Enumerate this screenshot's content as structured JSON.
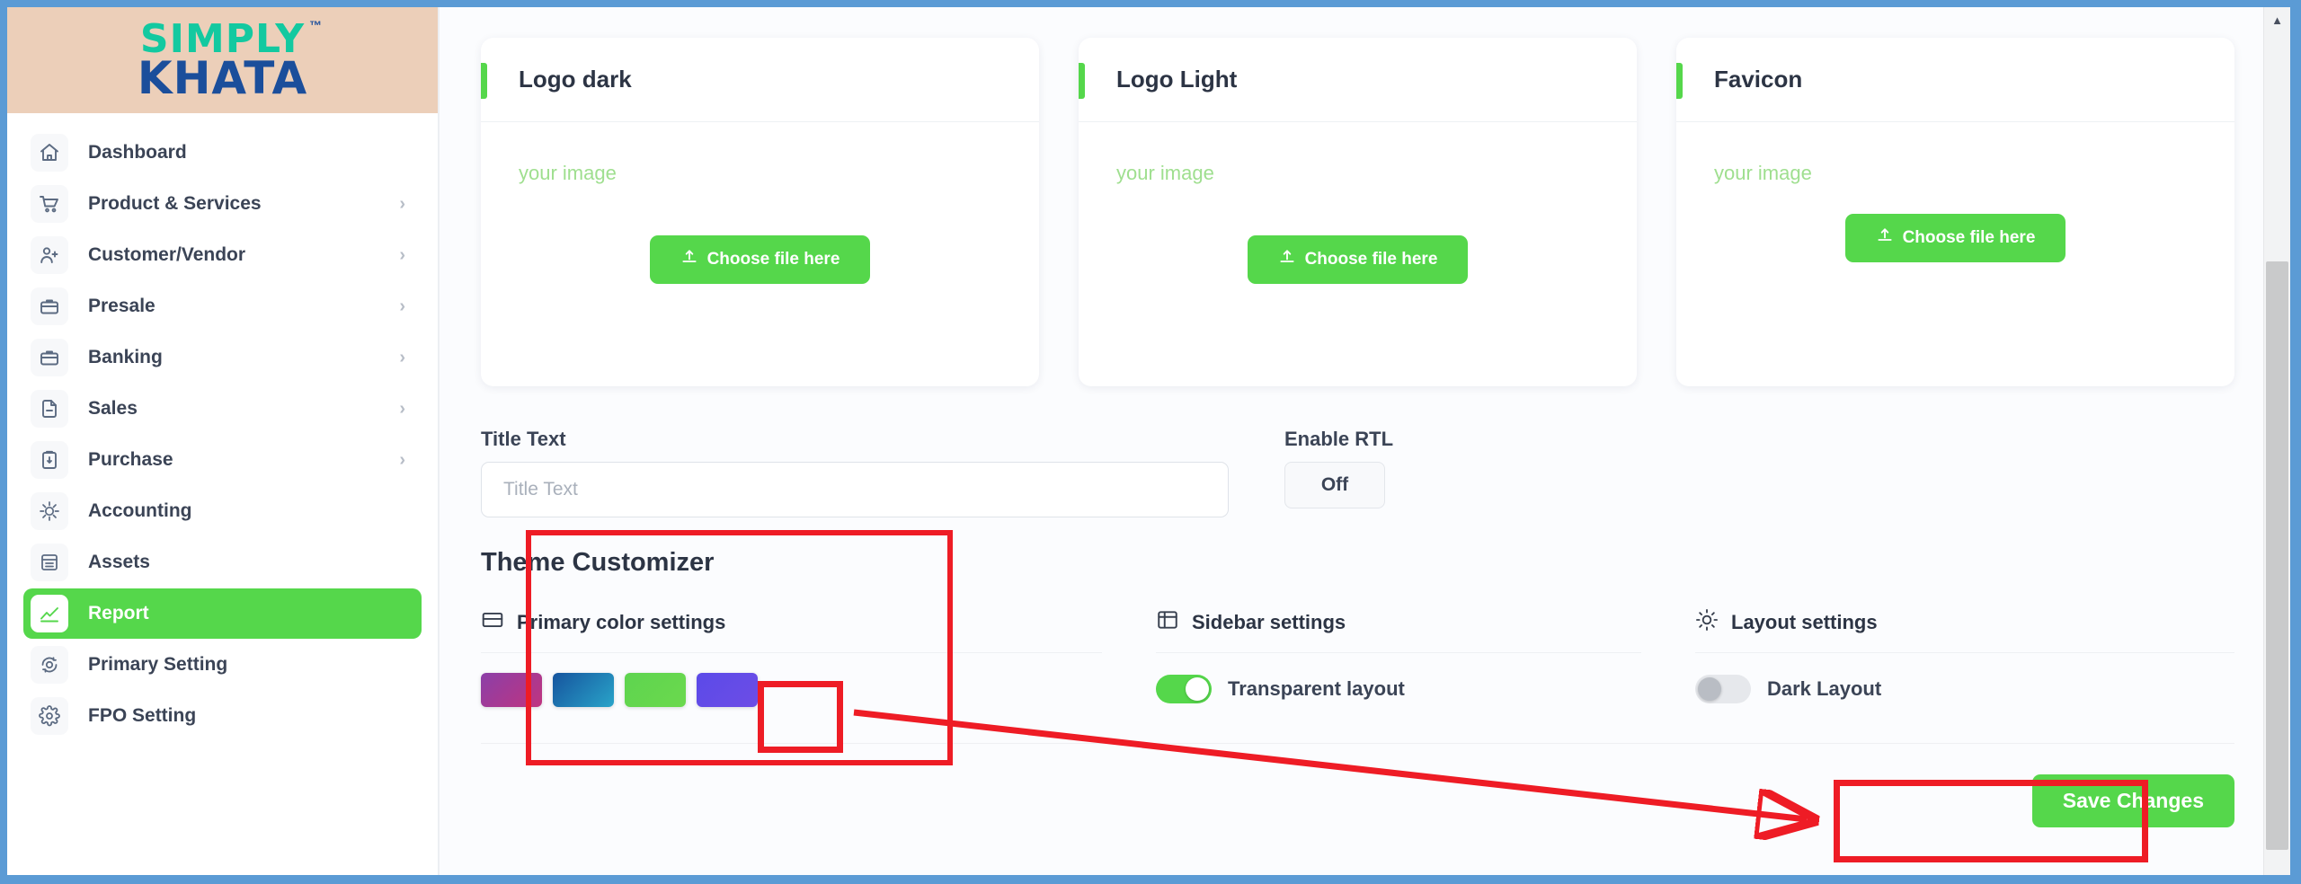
{
  "brand": {
    "logo_top": "SIMPLY",
    "logo_bottom": "KHATA",
    "trademark": "™",
    "logo_top_color": "#13c9a0",
    "logo_bottom_color": "#1b4e9b",
    "logo_bg": "#eccfb9"
  },
  "theme_colors": {
    "accent_green": "#55d74b",
    "annotation_red": "#ee1c25",
    "window_frame_blue": "#5b9bd5"
  },
  "sidebar": {
    "items": [
      {
        "label": "Dashboard",
        "icon": "home-icon",
        "expandable": false,
        "active": false
      },
      {
        "label": "Product & Services",
        "icon": "cart-icon",
        "expandable": true,
        "active": false
      },
      {
        "label": "Customer/Vendor",
        "icon": "user-add-icon",
        "expandable": true,
        "active": false
      },
      {
        "label": "Presale",
        "icon": "briefcase-icon",
        "expandable": true,
        "active": false
      },
      {
        "label": "Banking",
        "icon": "briefcase-icon",
        "expandable": true,
        "active": false
      },
      {
        "label": "Sales",
        "icon": "file-icon",
        "expandable": true,
        "active": false
      },
      {
        "label": "Purchase",
        "icon": "clipboard-icon",
        "expandable": true,
        "active": false
      },
      {
        "label": "Accounting",
        "icon": "accounting-icon",
        "expandable": false,
        "active": false
      },
      {
        "label": "Assets",
        "icon": "assets-icon",
        "expandable": false,
        "active": false
      },
      {
        "label": "Report",
        "icon": "report-chart-icon",
        "expandable": false,
        "active": true
      },
      {
        "label": "Primary Setting",
        "icon": "settings-gear-icon",
        "expandable": false,
        "active": false
      },
      {
        "label": "FPO Setting",
        "icon": "gear-icon",
        "expandable": false,
        "active": false
      }
    ],
    "chevron_glyph": "›"
  },
  "upload_cards": [
    {
      "title": "Logo dark",
      "placeholder_text": "your image",
      "button_label": "Choose file here",
      "button_icon": "upload-icon"
    },
    {
      "title": "Logo Light",
      "placeholder_text": "your image",
      "button_label": "Choose file here",
      "button_icon": "upload-icon"
    },
    {
      "title": "Favicon",
      "placeholder_text": "your image",
      "button_label": "Choose file here",
      "button_icon": "upload-icon"
    }
  ],
  "form": {
    "title_text": {
      "label": "Title Text",
      "placeholder": "Title Text",
      "value": ""
    },
    "enable_rtl": {
      "label": "Enable RTL",
      "state_label": "Off"
    }
  },
  "theme_customizer": {
    "heading": "Theme Customizer",
    "primary_color": {
      "icon": "palette-card-icon",
      "title": "Primary color settings",
      "swatches": [
        {
          "name": "purple-gradient",
          "css": "linear-gradient(135deg,#8b3fa8 0%,#c0347f 100%)",
          "selected": false
        },
        {
          "name": "blue-gradient",
          "css": "linear-gradient(135deg,#16549e 0%,#29a4c9 100%)",
          "selected": false
        },
        {
          "name": "green-solid",
          "css": "linear-gradient(135deg,#5ed44f 0%,#6bd94e 100%)",
          "selected": false
        },
        {
          "name": "indigo-solid",
          "css": "linear-gradient(135deg,#5b4ae8 0%,#6d4de6 100%)",
          "selected": true
        }
      ]
    },
    "sidebar_settings": {
      "icon": "sidebar-layout-icon",
      "title": "Sidebar settings",
      "toggle": {
        "label": "Transparent layout",
        "on": true
      }
    },
    "layout_settings": {
      "icon": "sun-icon",
      "title": "Layout settings",
      "toggle": {
        "label": "Dark Layout",
        "on": false
      }
    }
  },
  "footer": {
    "save_label": "Save Changes"
  },
  "scrollbar": {
    "up_arrow": "▲"
  }
}
